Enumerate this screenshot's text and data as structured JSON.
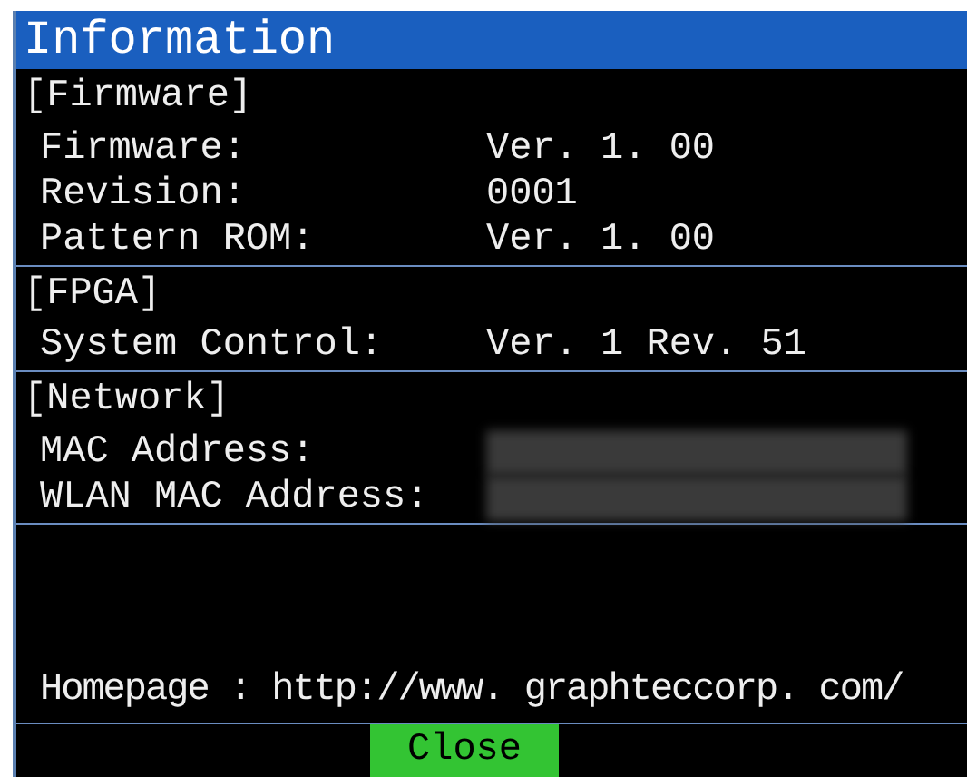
{
  "window": {
    "title": "Information"
  },
  "sections": [
    {
      "heading": "[Firmware]",
      "rows": [
        {
          "kind": "text",
          "label": "Firmware:",
          "value": "Ver. 1. 00"
        },
        {
          "kind": "text",
          "label": "Revision:",
          "value": "0001"
        },
        {
          "kind": "text",
          "label": "Pattern ROM:",
          "value": "Ver. 1. 00"
        }
      ]
    },
    {
      "heading": "[FPGA]",
      "rows": [
        {
          "kind": "text",
          "label": "System Control:",
          "value": "Ver. 1 Rev. 51"
        }
      ]
    },
    {
      "heading": "[Network]",
      "rows": [
        {
          "kind": "redacted",
          "label": "MAC Address:"
        },
        {
          "kind": "redacted",
          "label": "WLAN MAC Address:"
        }
      ]
    }
  ],
  "homepage": "Homepage : http://www. graphteccorp. com/",
  "buttons": [
    {
      "label": "Close"
    }
  ]
}
